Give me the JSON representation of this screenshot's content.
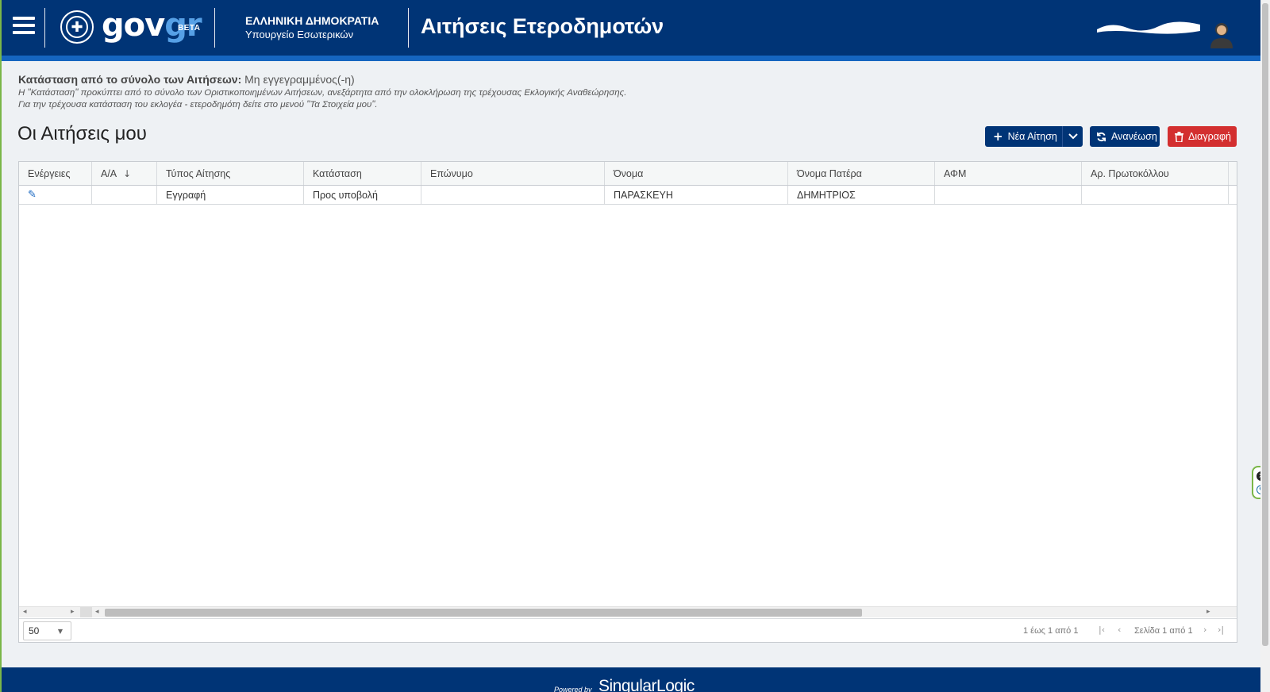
{
  "header": {
    "logo_main": "gov",
    "logo_accent": "gr",
    "beta": "BETA",
    "org_title": "ΕΛΛΗΝΙΚΗ ΔΗΜΟΚΡΑΤΙΑ",
    "org_subtitle": "Υπουργείο Εσωτερικών",
    "app_title": "Αιτήσεις Ετεροδημοτών"
  },
  "status": {
    "label": "Κατάσταση από το σύνολο των Αιτήσεων:",
    "value": "Μη εγγεγραμμένος(-η)",
    "note1": "Η \"Κατάσταση\" προκύπτει από το σύνολο των Οριστικοποιημένων Αιτήσεων, ανεξάρτητα από την ολοκλήρωση της τρέχουσας Εκλογικής Αναθεώρησης.",
    "note2": "Για την τρέχουσα κατάσταση του εκλογέα - ετεροδημότη δείτε στο μενού \"Τα Στοιχεία μου\"."
  },
  "page_title": "Οι Αιτήσεις μου",
  "toolbar": {
    "new_label": "Νέα Αίτηση",
    "refresh_label": "Ανανέωση",
    "delete_label": "Διαγραφή"
  },
  "grid": {
    "columns": [
      "Ενέργειες",
      "Α/Α",
      "Τύπος Αίτησης",
      "Κατάσταση",
      "Επώνυμο",
      "Όνομα",
      "Όνομα Πατέρα",
      "ΑΦΜ",
      "Αρ. Πρωτοκόλλου"
    ],
    "rows": [
      {
        "aa": "",
        "type": "Εγγραφή",
        "status": "Προς υποβολή",
        "surname": "",
        "name": "ΠΑΡΑΣΚΕΥΗ",
        "father": "ΔΗΜΗΤΡΙΟΣ",
        "afm": "",
        "protocol": ""
      }
    ]
  },
  "footer_bar": {
    "page_size": "50",
    "rows_info": "1 έως 1 από 1",
    "page_info": "Σελίδα 1 από 1"
  },
  "site_footer": {
    "powered_by": "Powered by",
    "brand": "SingularLogic"
  },
  "colors": {
    "header_bg": "#003476",
    "header_stripe": "#1565c0",
    "delete_button": "#d32f2f",
    "accent_green": "#7ab648"
  },
  "icons": {
    "menu": "hamburger-icon",
    "emblem": "greek-emblem-icon",
    "avatar": "user-avatar-icon",
    "new": "plus-icon",
    "dropdown": "chevron-down-icon",
    "refresh": "refresh-icon",
    "delete": "trash-icon",
    "edit": "pencil-icon",
    "sort": "arrow-down-icon"
  }
}
